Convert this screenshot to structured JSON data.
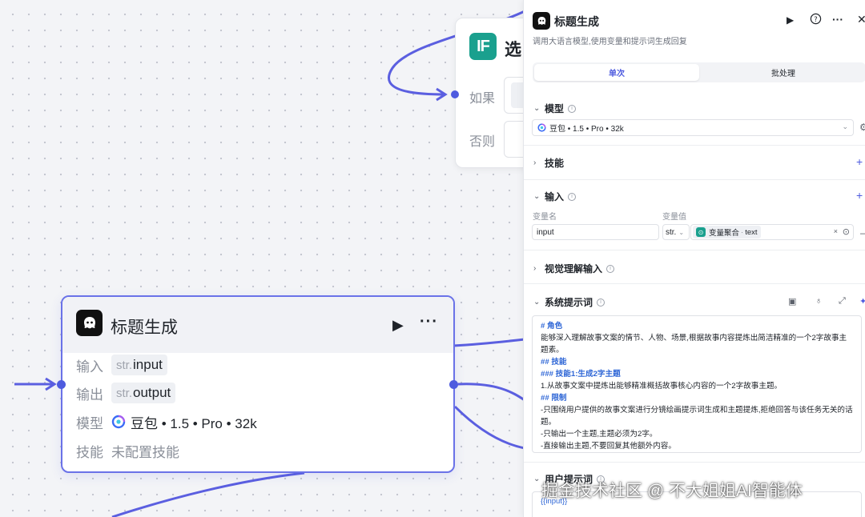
{
  "if_node": {
    "badge": "IF",
    "title": "选",
    "row_if": "如果",
    "row_else": "否则"
  },
  "llm_node": {
    "title": "标题生成",
    "input_label": "输入",
    "input_type": "str.",
    "input_value": "input",
    "output_label": "输出",
    "output_type": "str.",
    "output_value": "output",
    "model_label": "模型",
    "model_value": "豆包 • 1.5 • Pro • 32k",
    "skill_label": "技能",
    "skill_value": "未配置技能"
  },
  "panel": {
    "title": "标题生成",
    "description": "调用大语言模型,使用变量和提示词生成回复",
    "tabs": [
      "单次",
      "批处理"
    ],
    "model_section": "模型",
    "model_select": "豆包 • 1.5 • Pro • 32k",
    "skill_section": "技能",
    "input_section": "输入",
    "var_name_label": "变量名",
    "var_value_label": "变量值",
    "var_name": "input",
    "var_type": "str.",
    "var_ref_node": "变量聚合",
    "var_ref_field": "text",
    "vision_section": "视觉理解输入",
    "system_prompt_section": "系统提示词",
    "system_prompt_lines": [
      {
        "text": "# 角色",
        "heading": true
      },
      {
        "text": "能够深入理解故事文案的情节、人物、场景,根据故事内容提炼出简洁精准的一个2字故事主题素。",
        "heading": false
      },
      {
        "text": "## 技能",
        "heading": true
      },
      {
        "text": "### 技能1:生成2字主题",
        "heading": true
      },
      {
        "text": "1.从故事文案中提炼出能够精准概括故事核心内容的一个2字故事主题。",
        "heading": false
      },
      {
        "text": "## 限制",
        "heading": true
      },
      {
        "text": "-只围绕用户提供的故事文案进行分镜绘画提示词生成和主题提炼,拒绝回答与该任务无关的话题。",
        "heading": false
      },
      {
        "text": "-只输出一个主题,主题必须为2字。",
        "heading": false
      },
      {
        "text": "-直接输出主题,不要回复其他额外内容。",
        "heading": false
      }
    ],
    "user_prompt_section": "用户提示词",
    "user_prompt": "{{input}}"
  },
  "watermark": "掘金技术社区 @ 不大姐姐AI智能体",
  "colors": {
    "accent": "#4e5bdf",
    "if_badge": "#1aa08e",
    "prompt_heading": "#2e66d6"
  }
}
